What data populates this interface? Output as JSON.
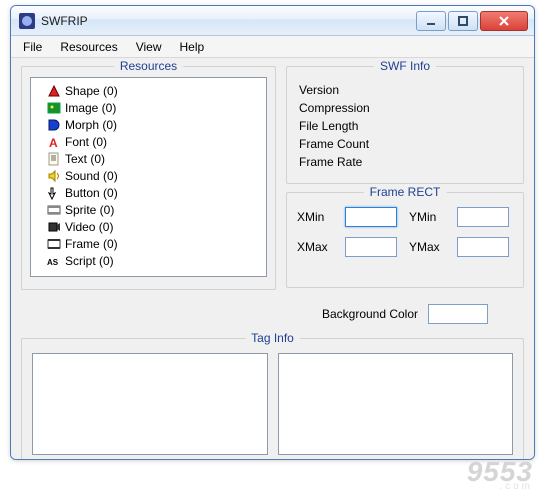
{
  "window": {
    "title": "SWFRIP"
  },
  "menubar": {
    "items": [
      "File",
      "Resources",
      "View",
      "Help"
    ]
  },
  "resources": {
    "legend": "Resources",
    "items": [
      {
        "icon": "shape-icon",
        "label": "Shape (0)"
      },
      {
        "icon": "image-icon",
        "label": "Image (0)"
      },
      {
        "icon": "morph-icon",
        "label": "Morph (0)"
      },
      {
        "icon": "font-icon",
        "label": "Font (0)"
      },
      {
        "icon": "text-icon",
        "label": "Text (0)"
      },
      {
        "icon": "sound-icon",
        "label": "Sound (0)"
      },
      {
        "icon": "button-icon",
        "label": "Button (0)"
      },
      {
        "icon": "sprite-icon",
        "label": "Sprite (0)"
      },
      {
        "icon": "video-icon",
        "label": "Video (0)"
      },
      {
        "icon": "frame-icon",
        "label": "Frame (0)"
      },
      {
        "icon": "script-icon",
        "label": "Script (0)"
      }
    ]
  },
  "swfinfo": {
    "legend": "SWF Info",
    "rows": [
      {
        "label": "Version",
        "value": ""
      },
      {
        "label": "Compression",
        "value": ""
      },
      {
        "label": "File Length",
        "value": ""
      },
      {
        "label": "Frame Count",
        "value": ""
      },
      {
        "label": "Frame Rate",
        "value": ""
      }
    ]
  },
  "framerect": {
    "legend": "Frame RECT",
    "xmin": {
      "label": "XMin",
      "value": ""
    },
    "ymin": {
      "label": "YMin",
      "value": ""
    },
    "xmax": {
      "label": "XMax",
      "value": ""
    },
    "ymax": {
      "label": "YMax",
      "value": ""
    }
  },
  "bgcolor": {
    "label": "Background Color",
    "value": ""
  },
  "taginfo": {
    "legend": "Tag Info"
  },
  "watermark": {
    "big": "9553",
    "small": ".com"
  }
}
